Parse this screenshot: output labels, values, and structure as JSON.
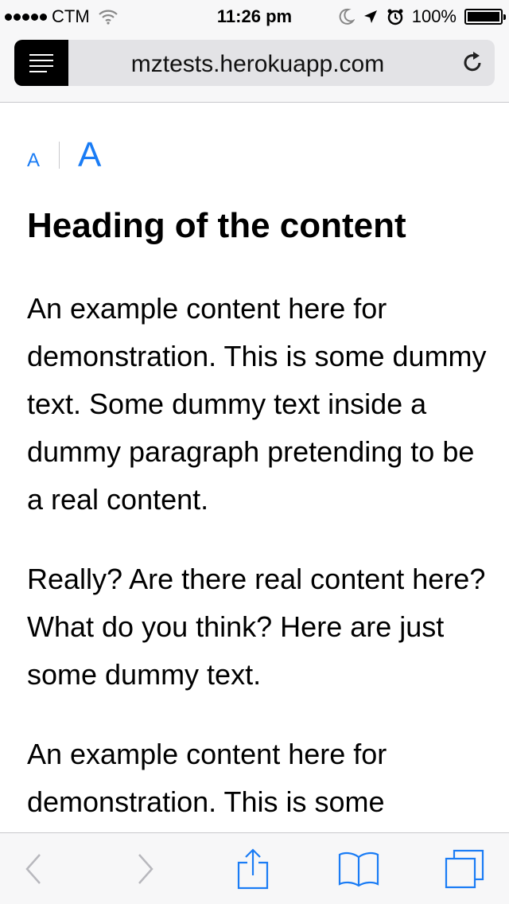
{
  "status_bar": {
    "carrier": "CTM",
    "time": "11:26 pm",
    "battery_percent": "100%",
    "battery_level": 1.0,
    "icons": [
      "signal-dots-icon",
      "wifi-icon",
      "do-not-disturb-moon-icon",
      "location-arrow-icon",
      "alarm-clock-icon",
      "battery-icon"
    ]
  },
  "address_bar": {
    "url": "mztests.herokuapp.com",
    "reader_icon": "reader-mode-icon",
    "reload_icon": "reload-icon"
  },
  "reader": {
    "font_small_label": "A",
    "font_large_label": "A",
    "heading": "Heading of the content",
    "paragraphs": [
      "An example content here for demonstration. This is some dummy text. Some dummy text inside a dummy paragraph pretending to be a real content.",
      "Really? Are there real content here? What do you think? Here are just some dummy text.",
      "An example content here for demonstration. This is some"
    ]
  },
  "toolbar": {
    "icons": [
      "back-icon",
      "forward-icon",
      "share-icon",
      "bookmarks-icon",
      "tabs-icon"
    ]
  },
  "colors": {
    "accent": "#1a7cf5",
    "disabled": "#b8b8bd",
    "bar_background": "#f7f7f8"
  }
}
